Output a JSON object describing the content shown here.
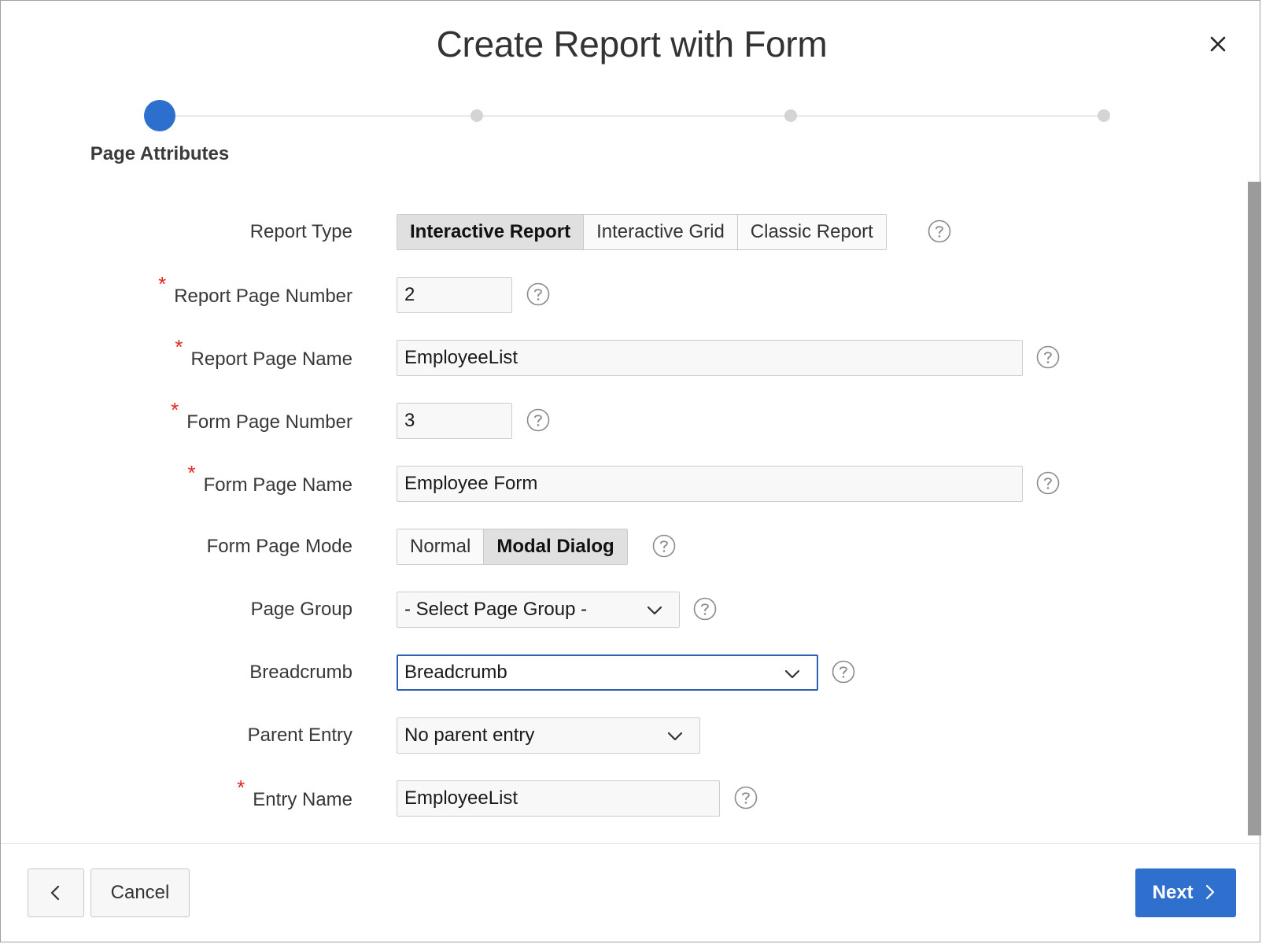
{
  "dialog": {
    "title": "Create Report with Form"
  },
  "wizard": {
    "current_step_label": "Page Attributes",
    "total_steps": 4,
    "current_step": 1
  },
  "form": {
    "report_type": {
      "label": "Report Type",
      "options": [
        "Interactive Report",
        "Interactive Grid",
        "Classic Report"
      ],
      "selected": "Interactive Report"
    },
    "report_page_number": {
      "label": "Report Page Number",
      "required": true,
      "value": "2"
    },
    "report_page_name": {
      "label": "Report Page Name",
      "required": true,
      "value": "EmployeeList"
    },
    "form_page_number": {
      "label": "Form Page Number",
      "required": true,
      "value": "3"
    },
    "form_page_name": {
      "label": "Form Page Name",
      "required": true,
      "value": "Employee Form"
    },
    "form_page_mode": {
      "label": "Form Page Mode",
      "options": [
        "Normal",
        "Modal Dialog"
      ],
      "selected": "Modal Dialog"
    },
    "page_group": {
      "label": "Page Group",
      "value": "- Select Page Group -"
    },
    "breadcrumb": {
      "label": "Breadcrumb",
      "value": "Breadcrumb"
    },
    "parent_entry": {
      "label": "Parent Entry",
      "value": "No parent entry"
    },
    "entry_name": {
      "label": "Entry Name",
      "required": true,
      "value": "EmployeeList"
    },
    "required_marker": "*"
  },
  "footer": {
    "back_icon": "chevron-left-icon",
    "cancel_label": "Cancel",
    "next_label": "Next",
    "next_icon": "chevron-right-icon"
  },
  "colors": {
    "accent": "#2f6fcd",
    "required": "#e0281d"
  }
}
